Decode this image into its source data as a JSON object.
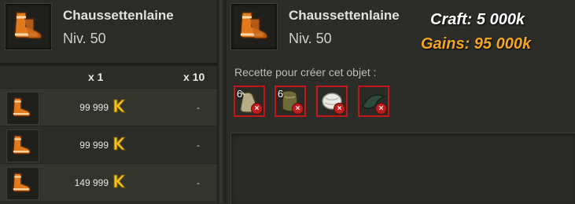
{
  "left_item": {
    "name": "Chaussettenlaine",
    "level": "Niv. 50",
    "icon": "wool-socks-icon"
  },
  "right_item": {
    "name": "Chaussettenlaine",
    "level": "Niv. 50",
    "icon": "wool-socks-icon"
  },
  "table": {
    "col_x1": "x 1",
    "col_x10": "x 10",
    "rows": [
      {
        "price": "99 999",
        "currency_icon": "kama-icon",
        "x10": "-"
      },
      {
        "price": "99 999",
        "currency_icon": "kama-icon",
        "x10": "-"
      },
      {
        "price": "149 999",
        "currency_icon": "kama-icon",
        "x10": "-"
      }
    ]
  },
  "overlay": {
    "craft": "Craft: 5 000k",
    "gains": "Gains: 95 000k"
  },
  "recipe": {
    "label": "Recette pour créer cet objet :",
    "ingredients": [
      {
        "qty": "6",
        "icon": "bag-icon"
      },
      {
        "qty": "6",
        "icon": "leather-icon"
      },
      {
        "qty": "",
        "icon": "wool-icon"
      },
      {
        "qty": "",
        "icon": "tail-icon"
      }
    ]
  },
  "colors": {
    "gains": "#f3a51b",
    "craft": "#ffffff",
    "missing": "#c0171a"
  }
}
